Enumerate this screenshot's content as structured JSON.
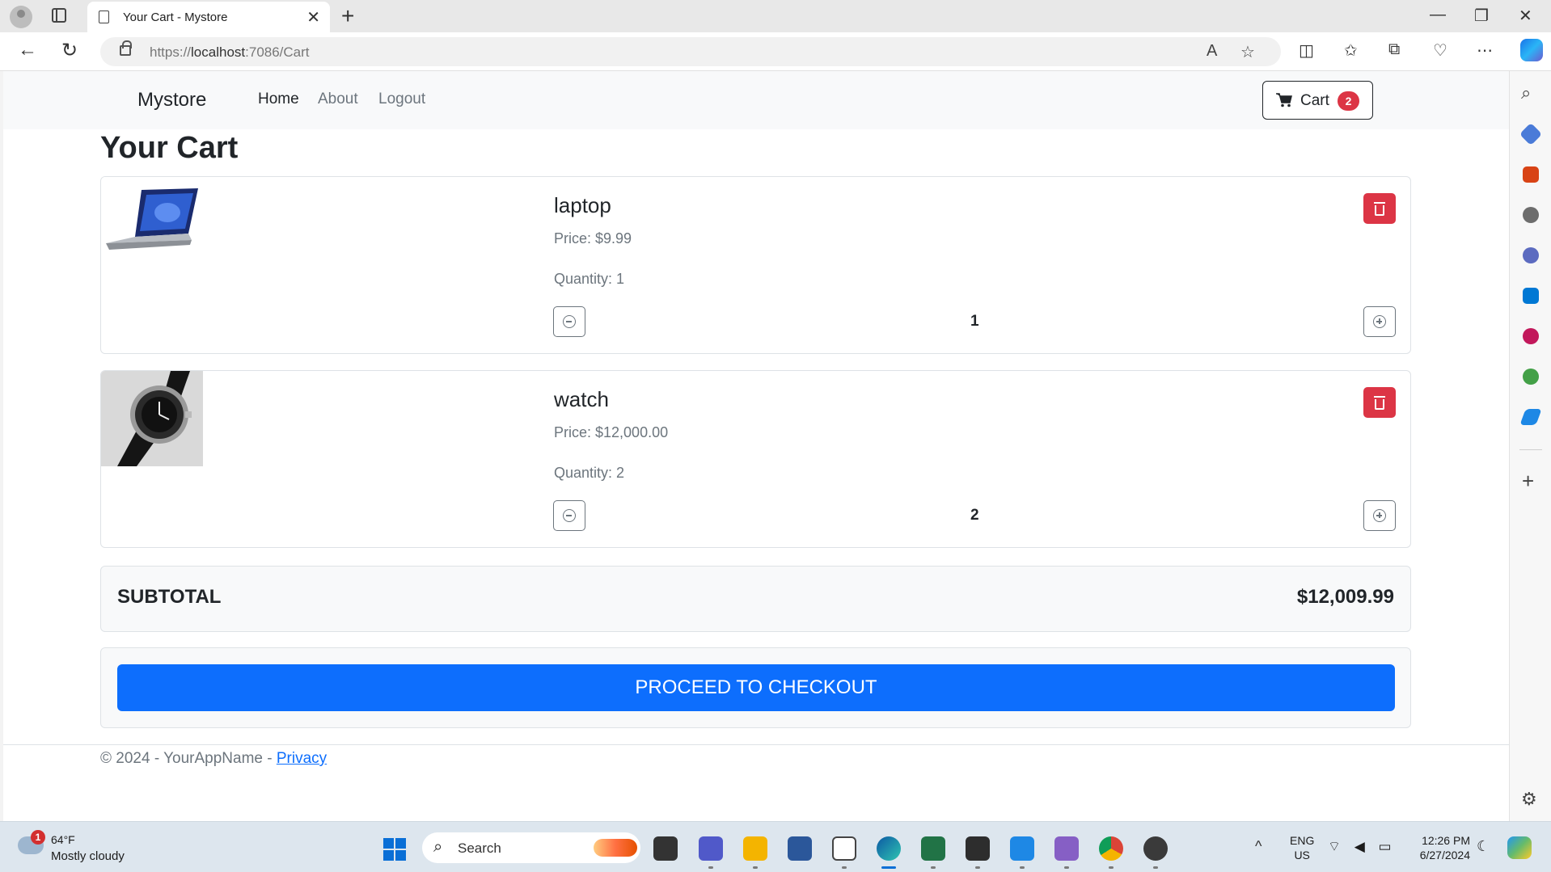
{
  "browser": {
    "tab_title": "Your Cart - Mystore",
    "url_protocol": "https://",
    "url_host": "localhost",
    "url_path": ":7086/Cart"
  },
  "site": {
    "brand": "Mystore",
    "nav": [
      {
        "label": "Home",
        "active": true
      },
      {
        "label": "About",
        "active": false
      },
      {
        "label": "Logout",
        "active": false
      }
    ],
    "cart_label": "Cart",
    "cart_count": "2"
  },
  "page": {
    "title": "Your Cart"
  },
  "cart_items": [
    {
      "name": "laptop",
      "price": "Price: $9.99",
      "quantity_text": "Quantity: 1",
      "quantity": "1"
    },
    {
      "name": "watch",
      "price": "Price: $12,000.00",
      "quantity_text": "Quantity: 2",
      "quantity": "2"
    }
  ],
  "subtotal": {
    "label": "SUBTOTAL",
    "value": "$12,009.99"
  },
  "checkout": {
    "label": "PROCEED TO CHECKOUT"
  },
  "footer": {
    "text": "© 2024 - YourAppName - ",
    "link": "Privacy"
  },
  "taskbar": {
    "weather_badge": "1",
    "temperature": "64°F",
    "weather": "Mostly cloudy",
    "search_label": "Search",
    "lang_line1": "ENG",
    "lang_line2": "US",
    "time": "12:26 PM",
    "date": "6/27/2024"
  },
  "colors": {
    "primary": "#0d6efd",
    "danger": "#dc3545",
    "muted": "#6c757d"
  }
}
